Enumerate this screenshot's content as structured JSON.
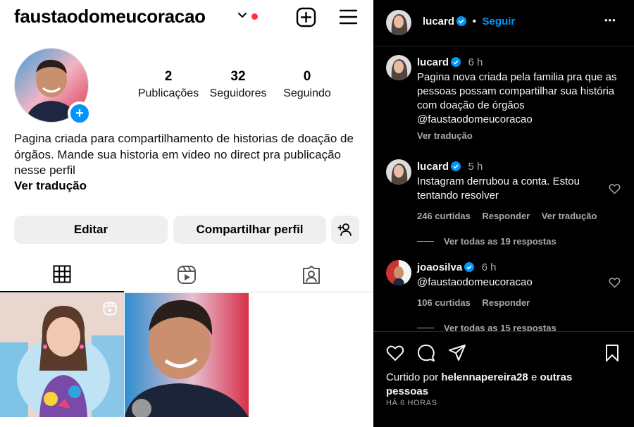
{
  "profile": {
    "username": "faustaodomeucoracao",
    "stats": [
      {
        "value": "2",
        "label": "Publicações"
      },
      {
        "value": "32",
        "label": "Seguidores"
      },
      {
        "value": "0",
        "label": "Seguindo"
      }
    ],
    "bio": "Pagina criada para compartilhamento de historias de doação de órgãos. Mande sua historia em video no direct pra publicação nesse perfil",
    "see_translation": "Ver tradução",
    "edit_label": "Editar",
    "share_label": "Compartilhar perfil"
  },
  "post": {
    "author": "lucard",
    "follow_label": "Seguir",
    "more_label": "•••",
    "comments": [
      {
        "user": "lucard",
        "time": "6 h",
        "text": "Pagina nova criada pela familia pra que as pessoas possam compartilhar sua história com doação de órgãos @faustaodomeucoracao",
        "translate": "Ver tradução"
      },
      {
        "user": "lucard",
        "time": "5 h",
        "text": "Instagram derrubou a conta. Estou tentando resolver",
        "likes": "246 curtidas",
        "reply": "Responder",
        "translate": "Ver tradução",
        "replies": "Ver todas as 19 respostas"
      },
      {
        "user": "joaosilva",
        "time": "6 h",
        "text": "@faustaodomeucoracao",
        "likes": "106 curtidas",
        "reply": "Responder",
        "replies": "Ver todas as 15 respostas"
      }
    ],
    "liked_by": "Curtido por helennapereira28 e outras pessoas",
    "liked_prefix": "Curtido por ",
    "liked_user": "helennapereira28",
    "liked_and": " e ",
    "liked_others": "outras pessoas",
    "time_ago": "HÁ 6 HORAS"
  },
  "colors": {
    "accent": "#0095f6",
    "notification": "#ff3040",
    "dark_bg": "#000000",
    "muted": "#a8a8a8"
  }
}
